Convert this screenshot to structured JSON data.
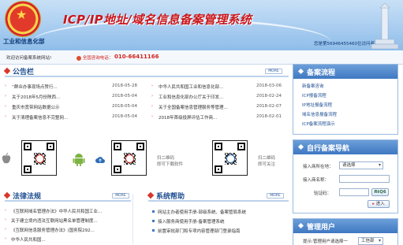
{
  "header": {
    "ministry": "工业和信息化部",
    "system_title": "ICP/IP地址/域名信息备案管理系统",
    "visitor_text": "您是第56946455460位访问者"
  },
  "subbar": {
    "welcome": "欢迎访问备案系统网站!",
    "hotline_label": "全国咨询电话：",
    "hotline_number": "010-66411166"
  },
  "announcements": {
    "title": "公告栏",
    "more": "MORE",
    "left": [
      {
        "title": "“群众办事现场点赞行...",
        "date": "2018-05-28"
      },
      {
        "title": "关于2018年5月份陕西...",
        "date": "2018-05-04"
      },
      {
        "title": "重庆市宽带网站数据公示",
        "date": "2018-05-04"
      },
      {
        "title": "关于清理备案信息不完整网...",
        "date": "2018-05-04"
      }
    ],
    "right": [
      {
        "title": "中华人民共和国工业和信息化部...",
        "date": "2018-03-06"
      },
      {
        "title": "工业和信息化部办公厅关于印发...",
        "date": "2018-02-24"
      },
      {
        "title": "关于全国备案信息管理服务等管理...",
        "date": "2018-02-07"
      },
      {
        "title": "2018年首级投屏评估工作商...",
        "date": "2018-02-01"
      }
    ]
  },
  "apps": {
    "caption_download": [
      "扫二维码",
      "即可下载软件"
    ],
    "caption_follow": [
      "扫二维码",
      "即可关注"
    ]
  },
  "law": {
    "title": "法律法规",
    "more": "MORE",
    "items": [
      "《互联网域名管理办法》中华人民共和国工业...",
      "关于建立境内违法互联网站黑名单管理制度...",
      "《互联网信息服务管理办法》(国务院292...",
      "中华人民共和国..."
    ]
  },
  "help": {
    "title": "系统帮助",
    "more": "MORE",
    "items": [
      "网站主办者使用手册-部级系统、备案管局系统",
      "接入服务商使用手册-备案管理系统",
      "前置审批部门和专项内容管理部门登录指南"
    ]
  },
  "sidebar": {
    "process": {
      "title": "备案流程",
      "items": [
        "新备案咨询",
        "ICP报备流程",
        "IP地址报备流程",
        "域名信息报备流程",
        "ICP备案流程演示"
      ]
    },
    "self_nav": {
      "title": "自行备案导航",
      "province_label": "接入商所在地：",
      "province_value": "请选择",
      "isp_label": "接入商名称：",
      "captcha_label": "验证码：",
      "captcha_value": "RtQ6",
      "enter_btn": "进入"
    },
    "admin": {
      "title": "管理用户",
      "hint_label": "提示:管理用户请选择一",
      "hint_value": "工信部"
    }
  }
}
